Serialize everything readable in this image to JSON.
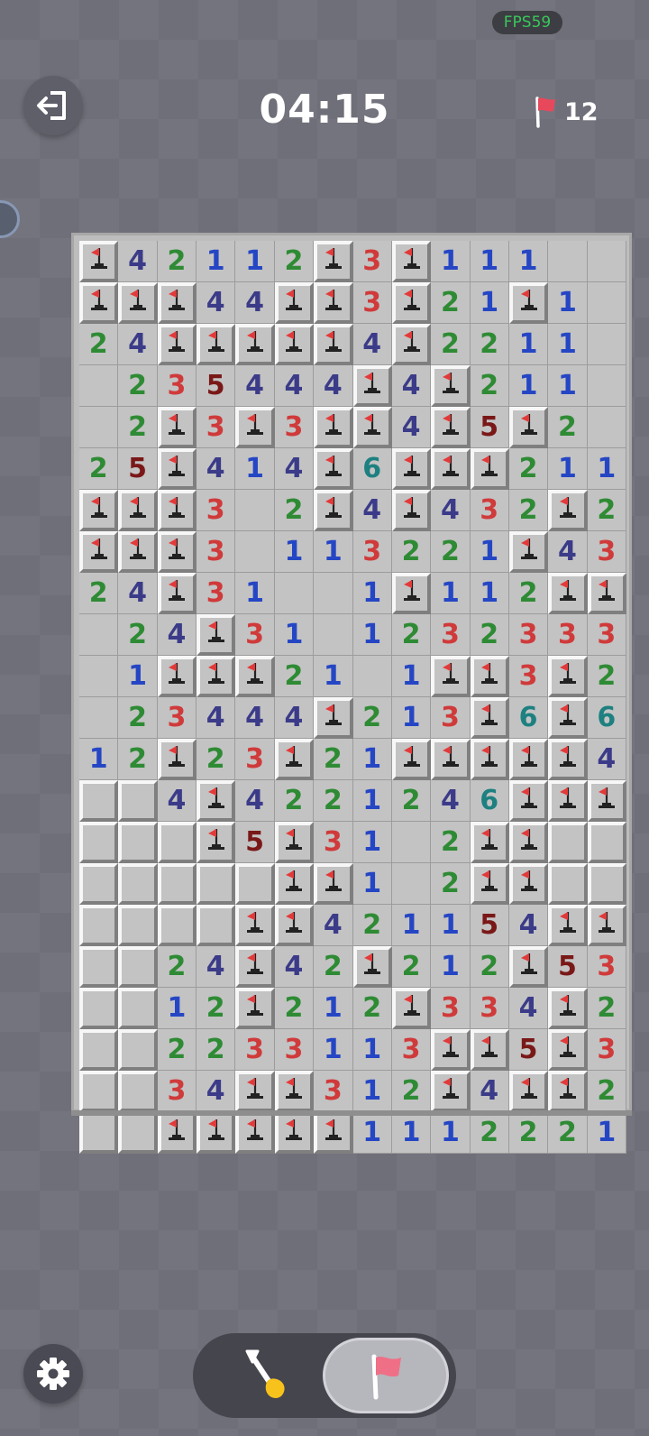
{
  "hud": {
    "fps_label": "FPS59",
    "timer": "04:15",
    "flags_remaining": "12"
  },
  "icons": {
    "exit": "exit-icon",
    "flag": "flag-icon",
    "mine_flag": "flagged-mine-icon",
    "settings": "gear-icon",
    "dig": "shovel-icon"
  },
  "colors": {
    "n1": "#2546c4",
    "n2": "#2e8b34",
    "n3": "#d03a3a",
    "n4": "#3b3b89",
    "n5": "#7a1818",
    "n6": "#1e8080",
    "flag": "#e8485c"
  },
  "board": {
    "cols": 14,
    "rows": 22,
    "legend": {
      "F": "flagged",
      "H": "hidden",
      ".": "open-empty",
      "digit": "open-number"
    },
    "cells": [
      "F42112F3F111..",
      "FFF44FF3F21F1.",
      "24FFFFF4F2211.",
      ".235444F4F211..",
      ".2F3F3FF4F5F2..",
      "25F414F6FFF211",
      "FFF3.2F4F432F2F",
      "FFF3.113221F43",
      "24F31..1F112FF",
      ".24F31.1232333",
      ".1FFF21.1FF3F2",
      ".23444F213F6F6F",
      "12F23F21FFFFF4",
      "HH4F4221246FFF",
      "HHHF5F31.2FFHH",
      "HHHHHFF1.2FFHH",
      "HHHHFF421154FFF",
      "HH24F42F212F53",
      "HH12F212F334F2",
      "HH2233113FF5F3",
      "HH34FF312F4FF2",
      "HHFFFFF1112221"
    ]
  },
  "controls": {
    "settings": "settings",
    "dig_mode": "dig",
    "flag_mode": "flag",
    "active_mode": "flag"
  }
}
